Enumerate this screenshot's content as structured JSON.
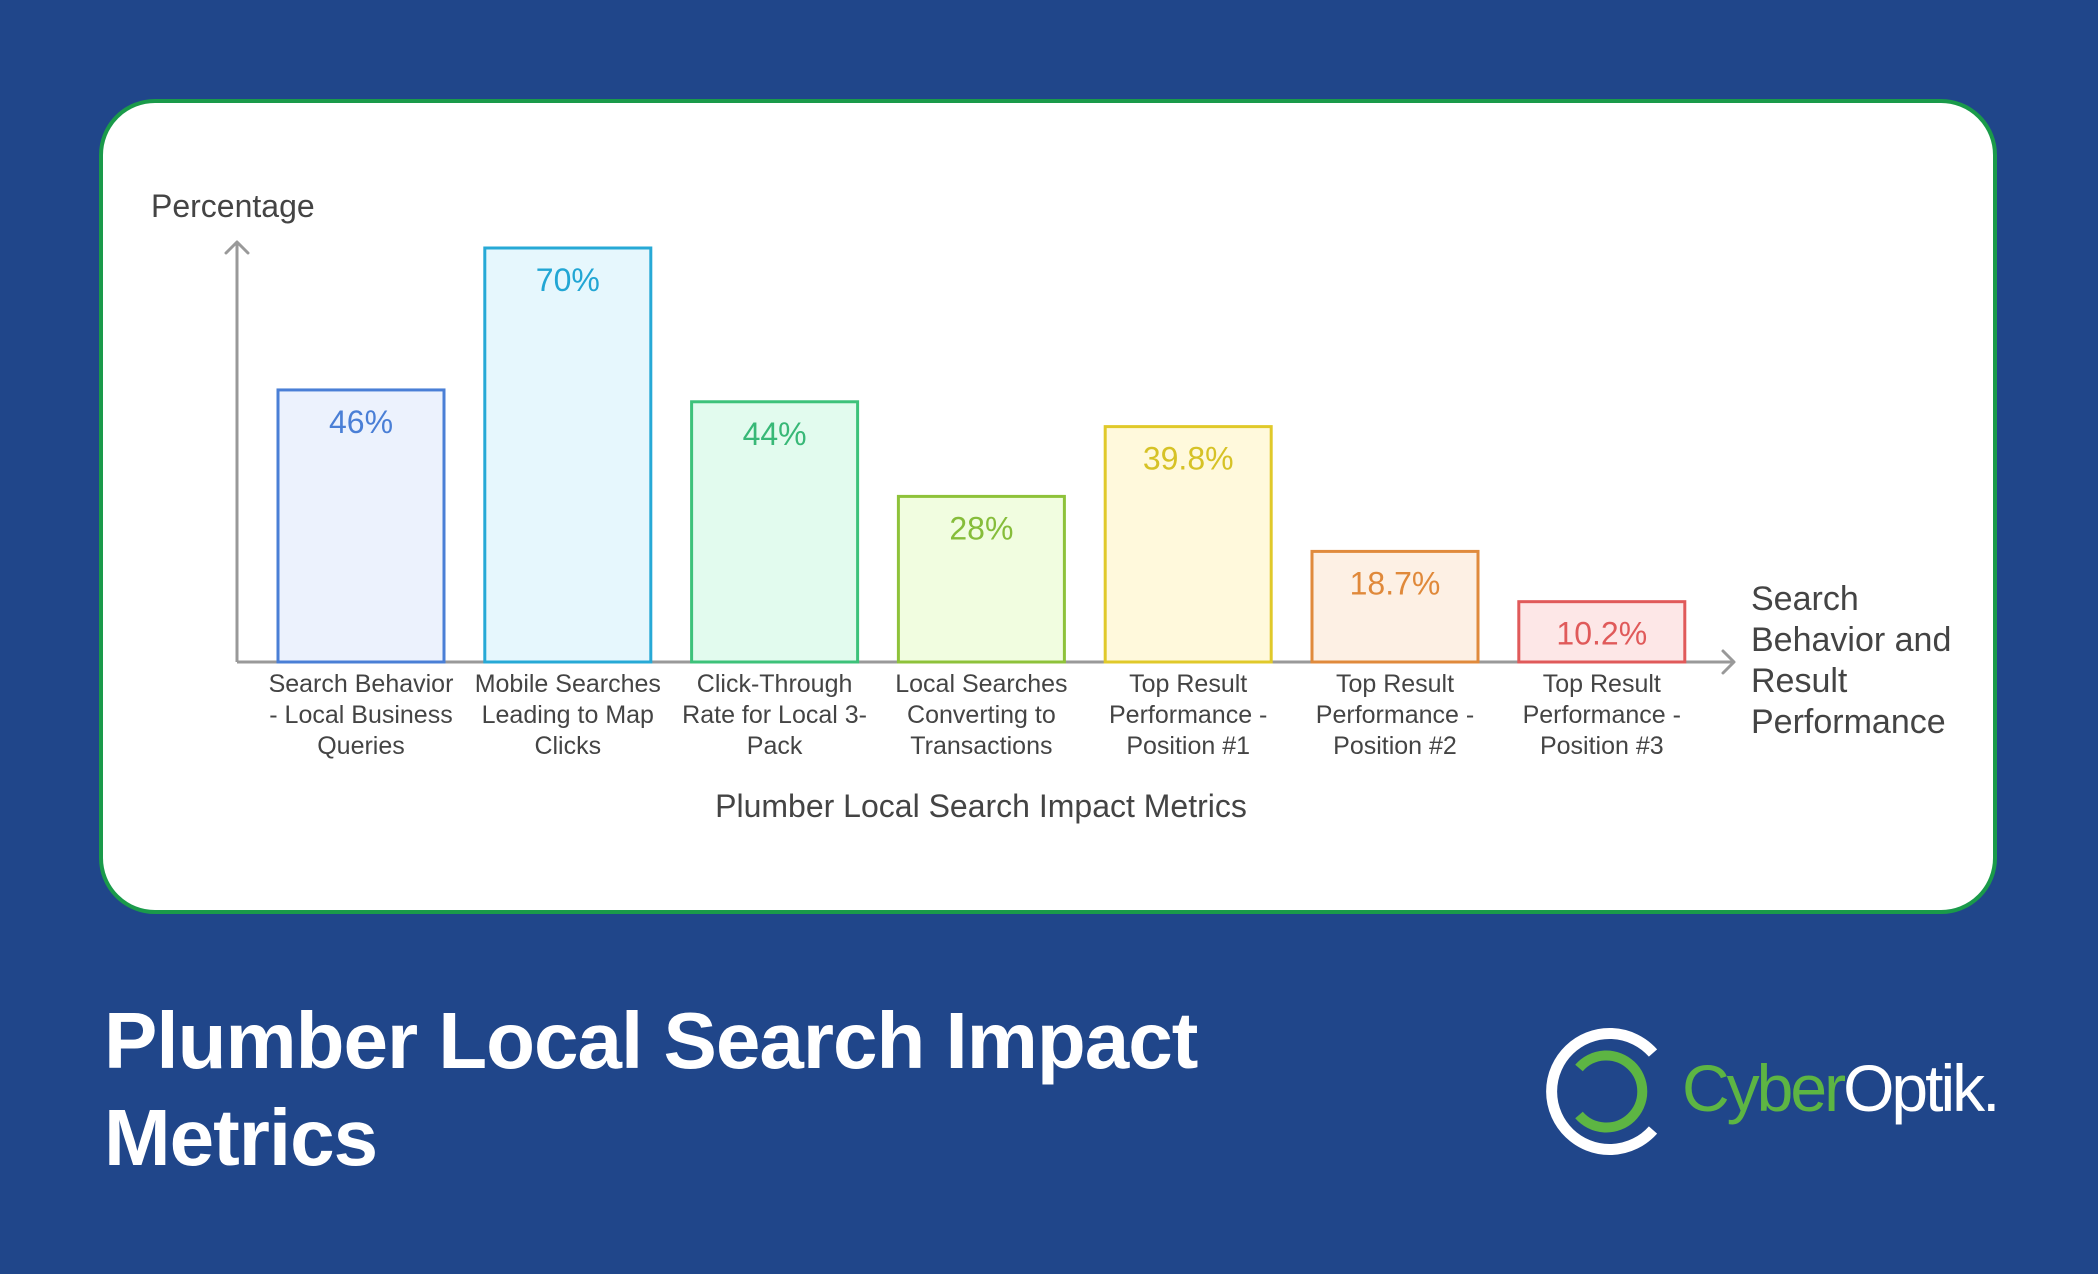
{
  "chart_data": {
    "type": "bar",
    "title": "Plumber Local Search Impact Metrics",
    "xlabel": "Plumber Local Search Impact Metrics",
    "ylabel": "Percentage",
    "x_axis_end_label": [
      "Search",
      "Behavior and",
      "Result",
      "Performance"
    ],
    "ylim": [
      0,
      70
    ],
    "grid": false,
    "categories": [
      "Search Behavior - Local Business Queries",
      "Mobile Searches Leading to Map Clicks",
      "Click-Through Rate for Local 3-Pack",
      "Local Searches Converting to Transactions",
      "Top Result Performance - Position #1",
      "Top Result Performance - Position #2",
      "Top Result Performance - Position #3"
    ],
    "category_label_lines": [
      [
        "Search Behavior",
        "- Local Business",
        "Queries"
      ],
      [
        "Mobile Searches",
        "Leading to Map",
        "Clicks"
      ],
      [
        "Click-Through",
        "Rate for Local 3-",
        "Pack"
      ],
      [
        "Local Searches",
        "Converting to",
        "Transactions"
      ],
      [
        "Top Result",
        "Performance -",
        "Position #1"
      ],
      [
        "Top Result",
        "Performance -",
        "Position #2"
      ],
      [
        "Top Result",
        "Performance -",
        "Position #3"
      ]
    ],
    "values": [
      46,
      70,
      44,
      28,
      39.8,
      18.7,
      10.2
    ],
    "value_labels": [
      "46%",
      "70%",
      "44%",
      "28%",
      "39.8%",
      "18.7%",
      "10.2%"
    ],
    "colors": [
      {
        "stroke": "#4a7fd6",
        "fill": "#ecf2fd",
        "text": "#4a7fd6"
      },
      {
        "stroke": "#27a9d6",
        "fill": "#e6f7fd",
        "text": "#22a6d4"
      },
      {
        "stroke": "#3dc27a",
        "fill": "#e2fbee",
        "text": "#38b877"
      },
      {
        "stroke": "#8ec23a",
        "fill": "#f1fde0",
        "text": "#86bd3a"
      },
      {
        "stroke": "#e0c92a",
        "fill": "#fff9dc",
        "text": "#d6c226"
      },
      {
        "stroke": "#e08a3c",
        "fill": "#fdf0e4",
        "text": "#e0893a"
      },
      {
        "stroke": "#e05a5a",
        "fill": "#fde7e7",
        "text": "#e05a5a"
      }
    ]
  },
  "page": {
    "title_lines": [
      "Plumber Local Search Impact",
      "Metrics"
    ],
    "background_color": "#20468a",
    "card_border_color": "#1a9a4a"
  },
  "logo": {
    "text_green": "Cyber",
    "text_white": "Optik.",
    "green": "#5db543",
    "white": "#ffffff"
  }
}
